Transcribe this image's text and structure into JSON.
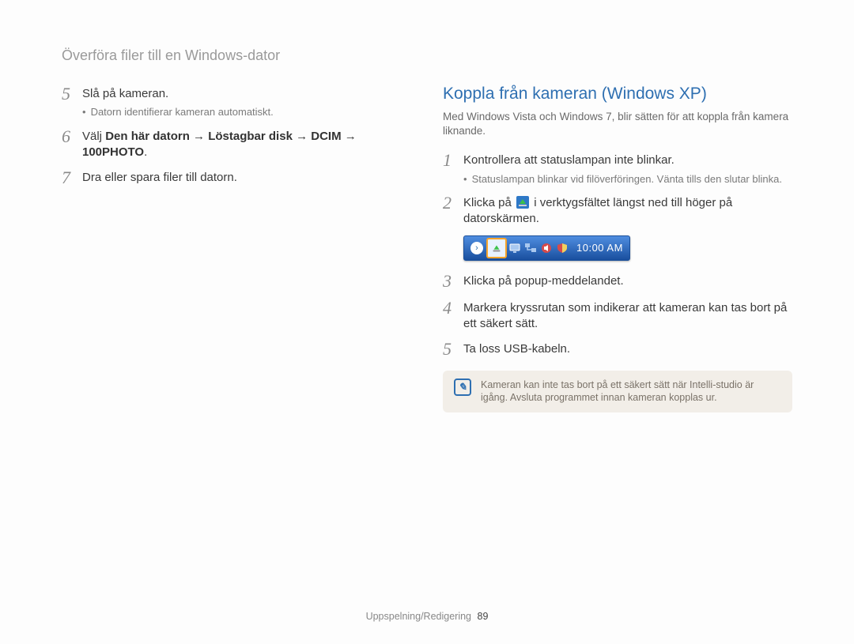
{
  "header": "Överföra filer till en Windows-dator",
  "left": {
    "step5": {
      "num": "5",
      "text": "Slå på kameran.",
      "sub": "Datorn identifierar kameran automatiskt."
    },
    "step6": {
      "num": "6",
      "text_prefix": "Välj ",
      "path1": "Den här datorn",
      "arrow": " → ",
      "path2": "Löstagbar disk",
      "path3": "DCIM",
      "path4": "100PHOTO",
      "period": "."
    },
    "step7": {
      "num": "7",
      "text": "Dra eller spara filer till datorn."
    }
  },
  "right": {
    "title": "Koppla från kameran (Windows XP)",
    "subtitle": "Med Windows Vista och Windows 7, blir sätten för att koppla från kamera liknande.",
    "step1": {
      "num": "1",
      "text": "Kontrollera att statuslampan inte blinkar.",
      "sub": "Statuslampan blinkar vid filöverföringen. Vänta tills den slutar blinka."
    },
    "step2": {
      "num": "2",
      "text_a": "Klicka på ",
      "text_b": " i verktygsfältet längst ned till höger på datorskärmen."
    },
    "tray": {
      "time": "10:00 AM",
      "icons": {
        "chevron": "chevron-right-icon",
        "eject": "safely-remove-icon",
        "display": "display-icon",
        "network": "network-icon",
        "volume": "volume-icon",
        "shield": "shield-icon"
      }
    },
    "step3": {
      "num": "3",
      "text": "Klicka på popup-meddelandet."
    },
    "step4": {
      "num": "4",
      "text": "Markera kryssrutan som indikerar att kameran kan tas bort på ett säkert sätt."
    },
    "step5": {
      "num": "5",
      "text": "Ta loss USB-kabeln."
    },
    "note": "Kameran kan inte tas bort på ett säkert sätt när Intelli-studio är igång. Avsluta programmet innan kameran kopplas ur."
  },
  "footer": {
    "section": "Uppspelning/Redigering",
    "page": "89"
  }
}
